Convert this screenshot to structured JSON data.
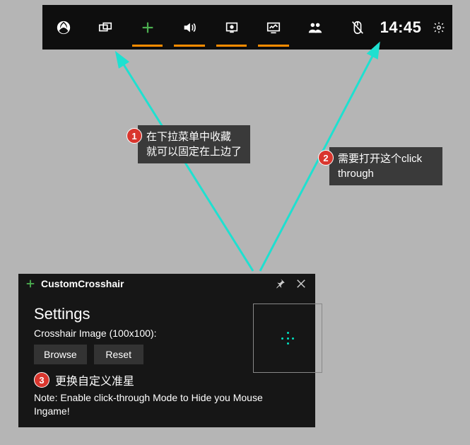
{
  "topbar": {
    "clock": "14:45"
  },
  "annotations": {
    "a1": {
      "num": "1",
      "text": "在下拉菜单中收藏\n就可以固定在上边了"
    },
    "a2": {
      "num": "2",
      "text": "需要打开这个click through"
    },
    "a3": {
      "num": "3",
      "text": "更换自定义准星"
    }
  },
  "panel": {
    "title": "CustomCrosshair",
    "settings_heading": "Settings",
    "field_label": "Crosshair Image (100x100):",
    "browse_label": "Browse",
    "reset_label": "Reset",
    "note": "Note: Enable click-through Mode to Hide you Mouse Ingame!"
  }
}
